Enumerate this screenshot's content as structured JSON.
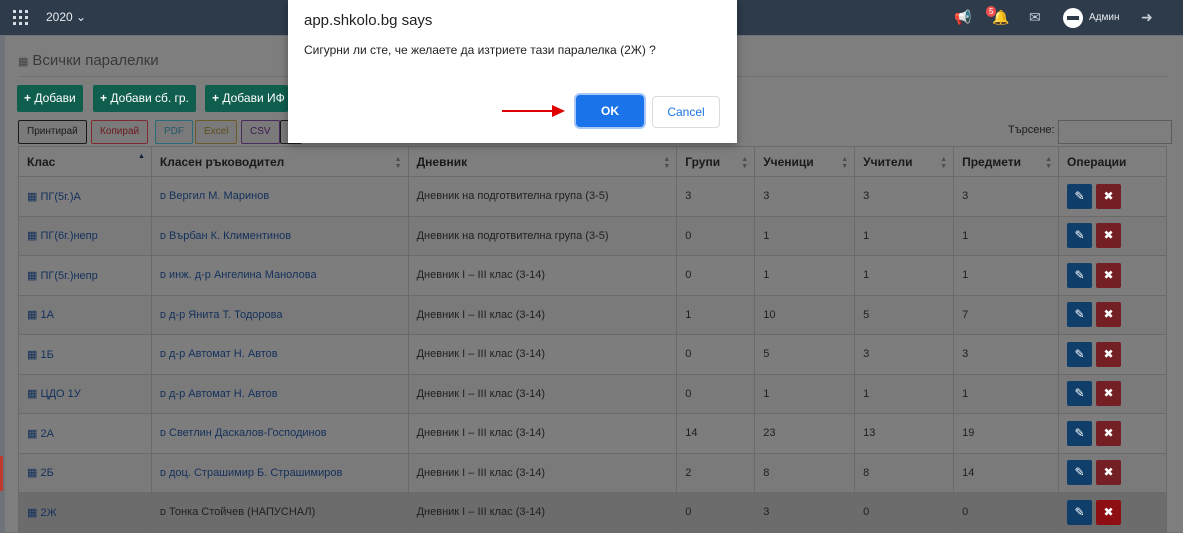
{
  "topbar": {
    "year": "2020",
    "notification_count": "5",
    "user_name": "Админ"
  },
  "page": {
    "title": "Всички паралелки"
  },
  "actions": {
    "add": "Добави",
    "add_group": "Добави сб. гр.",
    "add_if": "Добави ИФ"
  },
  "export": {
    "print": "Принтирай",
    "copy": "Копирай",
    "pdf": "PDF",
    "excel": "Excel",
    "csv": "CSV"
  },
  "search": {
    "label": "Търсене:",
    "value": ""
  },
  "table": {
    "columns": [
      "Клас",
      "Класен ръководител",
      "Дневник",
      "Групи",
      "Ученици",
      "Учители",
      "Предмети",
      "Операции"
    ],
    "rows": [
      {
        "klass": "ПГ(5г.)А",
        "teacher": "Вергил М. Маринов",
        "diary": "Дневник на подготвителна група (3-5)",
        "groups": "3",
        "students": "3",
        "teachers": "3",
        "subjects": "3"
      },
      {
        "klass": "ПГ(6г.)непр",
        "teacher": "Върбан К. Климентинов",
        "diary": "Дневник на подготвителна група (3-5)",
        "groups": "0",
        "students": "1",
        "teachers": "1",
        "subjects": "1"
      },
      {
        "klass": "ПГ(5г.)непр",
        "teacher": "инж. д-р Ангелина Манолова",
        "diary": "Дневник I – III клас (3-14)",
        "groups": "0",
        "students": "1",
        "teachers": "1",
        "subjects": "1"
      },
      {
        "klass": "1А",
        "teacher": "д-р Янита Т. Тодорова",
        "diary": "Дневник I – III клас (3-14)",
        "groups": "1",
        "students": "10",
        "teachers": "5",
        "subjects": "7"
      },
      {
        "klass": "1Б",
        "teacher": "д-р Автомат Н. Автов",
        "diary": "Дневник I – III клас (3-14)",
        "groups": "0",
        "students": "5",
        "teachers": "3",
        "subjects": "3"
      },
      {
        "klass": "ЦДО 1У",
        "teacher": "д-р Автомат Н. Автов",
        "diary": "Дневник I – III клас (3-14)",
        "groups": "0",
        "students": "1",
        "teachers": "1",
        "subjects": "1"
      },
      {
        "klass": "2А",
        "teacher": "Светлин Даскалов-Господинов",
        "diary": "Дневник I – III клас (3-14)",
        "groups": "14",
        "students": "23",
        "teachers": "13",
        "subjects": "19"
      },
      {
        "klass": "2Б",
        "teacher": "доц. Страшимир Б. Страшимиров",
        "diary": "Дневник I – III клас (3-14)",
        "groups": "2",
        "students": "8",
        "teachers": "8",
        "subjects": "14"
      },
      {
        "klass": "2Ж",
        "teacher": "Тонка Стойчев (НАПУСНАЛ)",
        "diary": "Дневник I – III клас (3-14)",
        "groups": "0",
        "students": "3",
        "teachers": "0",
        "subjects": "0"
      }
    ]
  },
  "dialog": {
    "title": "app.shkolo.bg says",
    "message": "Сигурни ли сте, че желаете да изтриете тази паралелка (2Ж) ?",
    "ok": "OK",
    "cancel": "Cancel"
  },
  "colors": {
    "topbar": "#2e3b4b",
    "ok_button": "#1a73e8",
    "edit_button": "#1d7bd4",
    "delete_button": "#e3424d",
    "arrow": "#e00000"
  }
}
